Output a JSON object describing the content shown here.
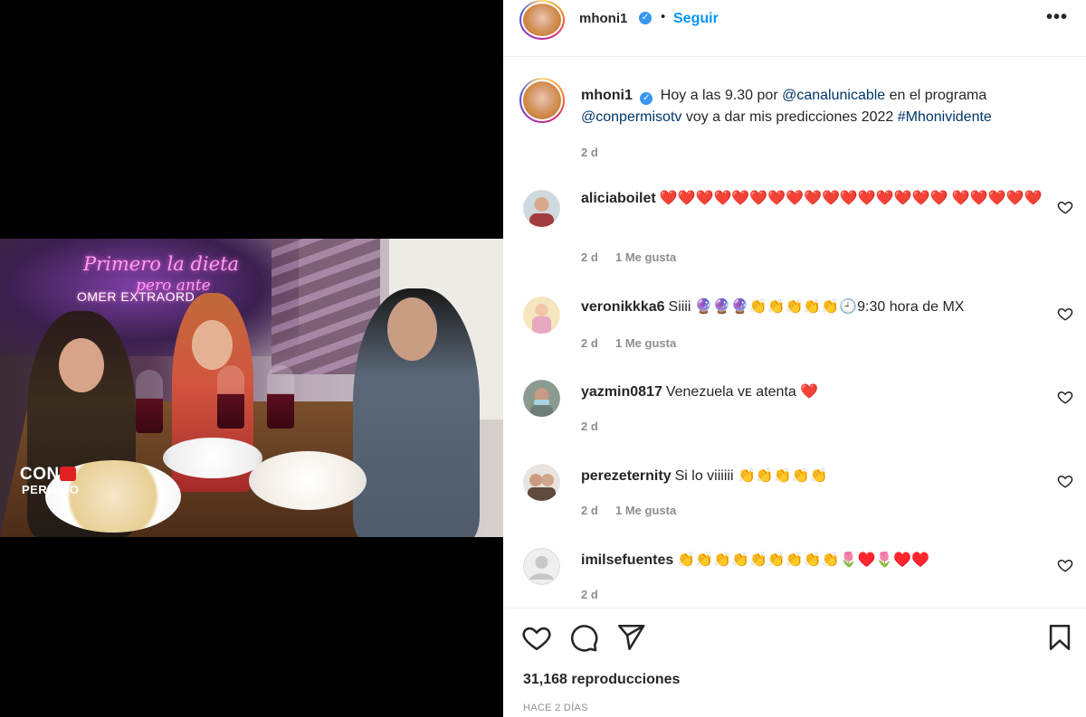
{
  "video": {
    "neon_line1": "Primero la dieta",
    "neon_line2": "pero ante",
    "neon_line3": "OMER EXTRAORD",
    "brand_top": "CON",
    "brand_bottom": "PERMISO"
  },
  "header": {
    "username": "mhoni1",
    "separator": "•",
    "follow_label": "Seguir",
    "more_label": "•••"
  },
  "caption": {
    "username": "mhoni1",
    "text_part1": "Hoy a las 9.30 por ",
    "mention1": "@canalunicable",
    "text_part2": " en el programa ",
    "mention2": "@conpermisotv",
    "text_part3": " voy a dar mis predicciones 2022 ",
    "hashtag": "#Mhonividente",
    "time": "2 d"
  },
  "comments": [
    {
      "username": "aliciaboilet",
      "text": "❤️❤️❤️❤️❤️❤️❤️❤️❤️❤️❤️❤️❤️❤️❤️❤️ ❤️❤️❤️❤️❤️",
      "time": "2 d",
      "likes": "1 Me gusta",
      "avatar_color": "#a33c3c"
    },
    {
      "username": "veronikkka6",
      "text": "Siiii 🔮🔮🔮👏👏👏👏👏🕘9:30 hora de MX",
      "time": "2 d",
      "likes": "1 Me gusta",
      "avatar_color": "#e7a9c0"
    },
    {
      "username": "yazmin0817",
      "text": "Venezuela ᴠᴇ atenta ❤️",
      "time": "2 d",
      "likes": "",
      "avatar_color": "#6d7e7a"
    },
    {
      "username": "perezeternity",
      "text": "Si lo viiiiii 👏👏👏👏👏",
      "time": "2 d",
      "likes": "1 Me gusta",
      "avatar_color": "#5e4a3f"
    },
    {
      "username": "imilsefuentes",
      "text": "👏👏👏👏👏👏👏👏👏🌷♥️🌷♥️♥️",
      "time": "2 d",
      "likes": "",
      "avatar_color": "#dcdcdc"
    }
  ],
  "footer": {
    "views": "31,168 reproducciones",
    "date": "HACE 2 DÍAS"
  }
}
